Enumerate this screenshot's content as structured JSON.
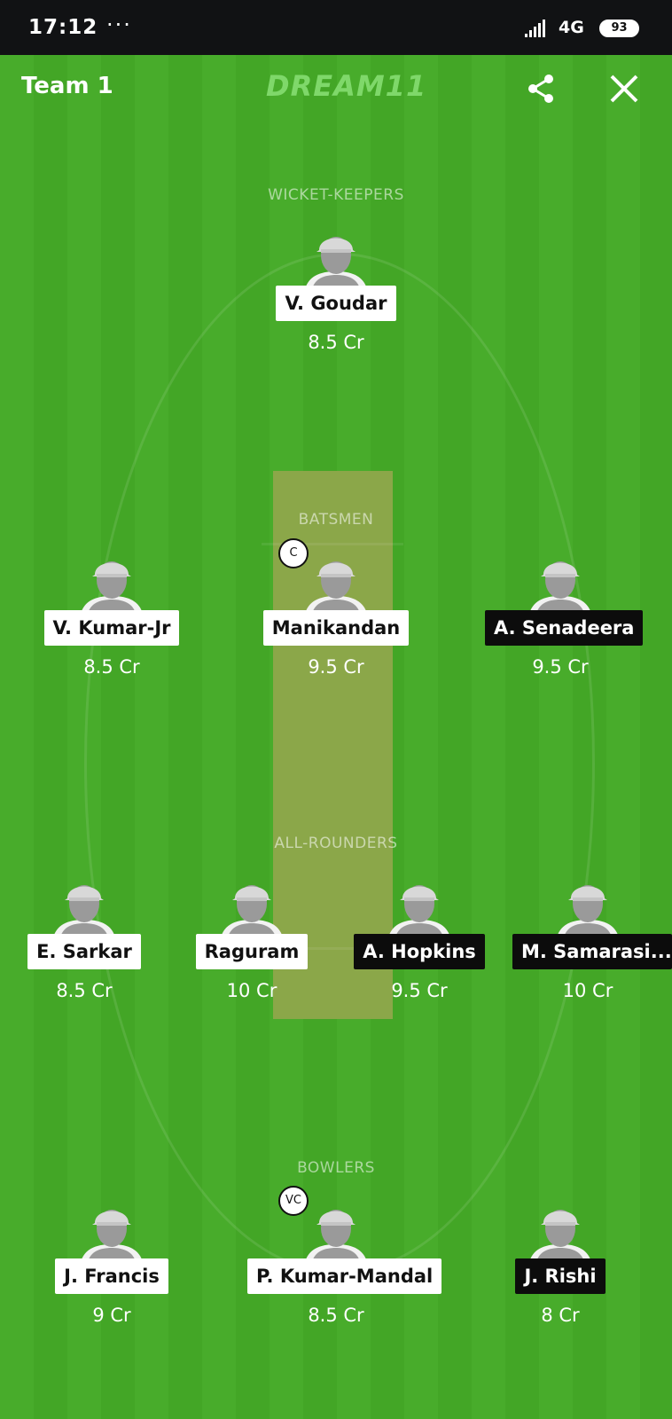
{
  "status_bar": {
    "time": "17:12",
    "dots": "···",
    "network": "4G",
    "network_sub": "all",
    "battery": "93"
  },
  "header": {
    "title": "Team 1",
    "logo": "DREAM11"
  },
  "sections": {
    "wicket_keepers": "WICKET-KEEPERS",
    "batsmen": "BATSMEN",
    "all_rounders": "ALL-ROUNDERS",
    "bowlers": "BOWLERS"
  },
  "badges": {
    "captain": "C",
    "vice_captain": "VC"
  },
  "players": {
    "wk": [
      {
        "name": "V. Goudar",
        "credits": "8.5 Cr",
        "tag": "white"
      }
    ],
    "bat": [
      {
        "name": "V. Kumar-Jr",
        "credits": "8.5 Cr",
        "tag": "white"
      },
      {
        "name": "Manikandan",
        "credits": "9.5 Cr",
        "tag": "white"
      },
      {
        "name": "A. Senadeera",
        "credits": "9.5 Cr",
        "tag": "black"
      }
    ],
    "ar": [
      {
        "name": "E. Sarkar",
        "credits": "8.5 Cr",
        "tag": "white"
      },
      {
        "name": "Raguram",
        "credits": "10 Cr",
        "tag": "white"
      },
      {
        "name": "A. Hopkins",
        "credits": "9.5 Cr",
        "tag": "black"
      },
      {
        "name": "M. Samarasi...",
        "credits": "10 Cr",
        "tag": "black"
      }
    ],
    "bowl": [
      {
        "name": "J. Francis",
        "credits": "9 Cr",
        "tag": "white"
      },
      {
        "name": "P. Kumar-Mandal",
        "credits": "8.5 Cr",
        "tag": "white"
      },
      {
        "name": "J. Rishi",
        "credits": "8 Cr",
        "tag": "black"
      }
    ]
  },
  "colors": {
    "field": "#48ac2b",
    "pitch": "#8fa64b",
    "logo": "#7fd86a"
  },
  "icons": {
    "share": "share-icon",
    "close": "close-icon",
    "player": "player-silhouette-icon"
  }
}
